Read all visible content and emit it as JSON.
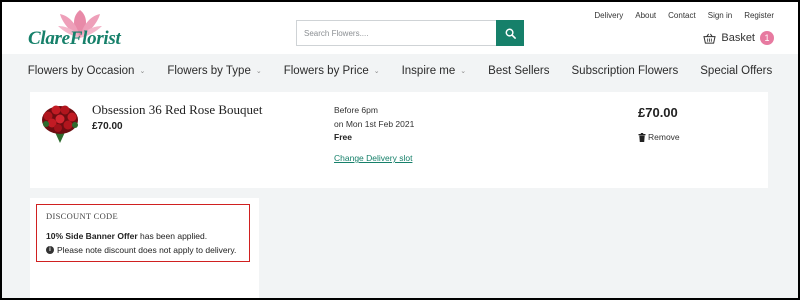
{
  "brand": {
    "logo_text": "ClareFlorist",
    "accent_color": "#16806a",
    "petal_color": "#e88aa8"
  },
  "search": {
    "placeholder": "Search Flowers....",
    "icon": "search-icon"
  },
  "top_links": [
    "Delivery",
    "About",
    "Contact",
    "Sign in",
    "Register"
  ],
  "basket": {
    "label": "Basket",
    "count": "1",
    "icon": "basket-icon"
  },
  "nav": {
    "items": [
      {
        "label": "Flowers by Occasion",
        "has_dropdown": true
      },
      {
        "label": "Flowers by Type",
        "has_dropdown": true
      },
      {
        "label": "Flowers by Price",
        "has_dropdown": true
      },
      {
        "label": "Inspire me",
        "has_dropdown": true
      },
      {
        "label": "Best Sellers",
        "has_dropdown": false
      },
      {
        "label": "Subscription Flowers",
        "has_dropdown": false
      },
      {
        "label": "Special Offers",
        "has_dropdown": false
      }
    ]
  },
  "cart": {
    "item": {
      "title": "Obsession 36 Red Rose Bouquet",
      "price": "£70.00",
      "delivery_line1": "Before 6pm",
      "delivery_line2": "on Mon 1st Feb 2021",
      "delivery_cost": "Free",
      "change_delivery_label": "Change Delivery slot",
      "total": "£70.00",
      "remove_label": "Remove"
    }
  },
  "discount": {
    "title": "DISCOUNT CODE",
    "offer_name": "10% Side Banner Offer",
    "applied_text": " has been applied.",
    "note": "Please note discount does not apply to delivery.",
    "highlight_color": "#d02020"
  }
}
